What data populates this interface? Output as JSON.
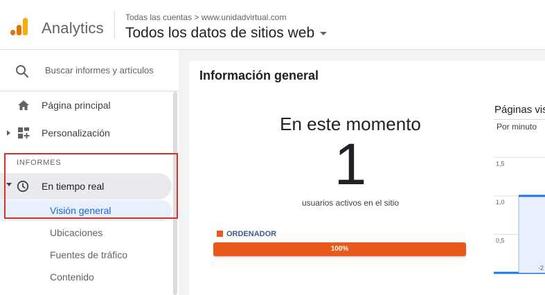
{
  "header": {
    "logo_icon": "analytics-logo-icon",
    "app_name": "Analytics",
    "breadcrumb": "Todas las cuentas > www.unidadvirtual.com",
    "property_selector": "Todos los datos de sitios web"
  },
  "sidebar": {
    "search_placeholder": "Buscar informes y artículos",
    "items": [
      {
        "label": "Página principal",
        "icon": "home-icon"
      },
      {
        "label": "Personalización",
        "icon": "dashboard-plus-icon"
      }
    ],
    "section_title": "INFORMES",
    "realtime": {
      "label": "En tiempo real",
      "icon": "clock-icon"
    },
    "realtime_subitems": [
      {
        "label": "Visión general",
        "active": true
      },
      {
        "label": "Ubicaciones"
      },
      {
        "label": "Fuentes de tráfico"
      },
      {
        "label": "Contenido"
      }
    ]
  },
  "main": {
    "title": "Información general",
    "right_now_heading": "En este momento",
    "active_users": "1",
    "active_users_label": "usuarios activos en el sitio",
    "device_label": "ORDENADOR",
    "device_percent": "100%",
    "device_fraction": 1.0,
    "pageviews_title": "Páginas vis",
    "pageviews_subtitle": "Por minuto"
  },
  "chart_data": {
    "type": "bar",
    "title": "Páginas vis",
    "subtitle": "Por minuto",
    "y_ticks": [
      "1,5",
      "1,0",
      "0,5"
    ],
    "ylim": [
      0,
      1.8
    ],
    "x_tick_partial": "-2",
    "values": [
      1.0
    ]
  },
  "colors": {
    "accent_orange": "#e8591a",
    "logo_orange": "#e37400",
    "logo_yellow": "#f9ab00",
    "active_blue": "#1967d2",
    "chart_blue": "#1a73e8",
    "highlight_red": "#d93025"
  }
}
